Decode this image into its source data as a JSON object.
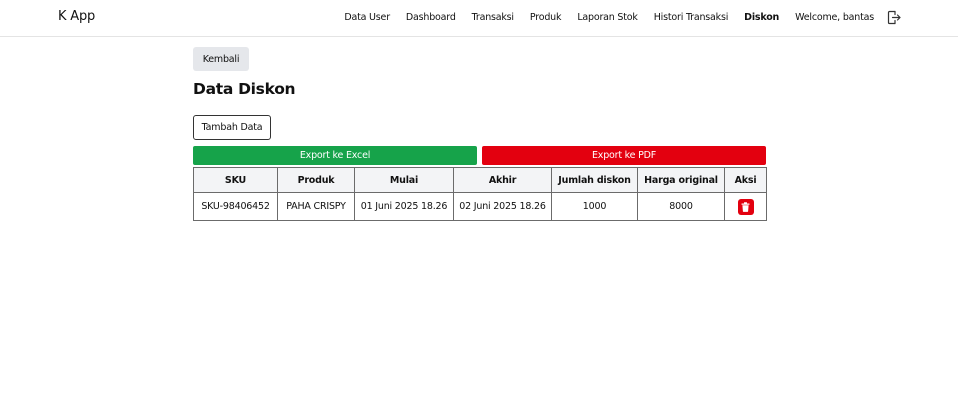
{
  "app": {
    "brand": "K App"
  },
  "nav": {
    "items": [
      {
        "label": "Data User"
      },
      {
        "label": "Dashboard"
      },
      {
        "label": "Transaksi"
      },
      {
        "label": "Produk"
      },
      {
        "label": "Laporan Stok"
      },
      {
        "label": "Histori Transaksi"
      },
      {
        "label": "Diskon",
        "active": true
      }
    ],
    "welcome": "Welcome, bantas",
    "logout_icon": "logout-icon"
  },
  "page": {
    "back_label": "Kembali",
    "title": "Data Diskon",
    "add_label": "Tambah Data",
    "export_excel_label": "Export ke Excel",
    "export_pdf_label": "Export ke PDF"
  },
  "colors": {
    "excel": "#16a34a",
    "pdf": "#e3000f",
    "delete": "#e3000f"
  },
  "table": {
    "columns": [
      "SKU",
      "Produk",
      "Mulai",
      "Akhir",
      "Jumlah diskon",
      "Harga original",
      "Aksi"
    ],
    "rows": [
      {
        "sku": "SKU-98406452",
        "produk": "PAHA CRISPY",
        "mulai": "01 Juni 2025 18.26",
        "akhir": "02 Juni 2025 18.26",
        "jumlah_diskon": "1000",
        "harga_original": "8000",
        "action_icon": "trash-icon"
      }
    ]
  }
}
